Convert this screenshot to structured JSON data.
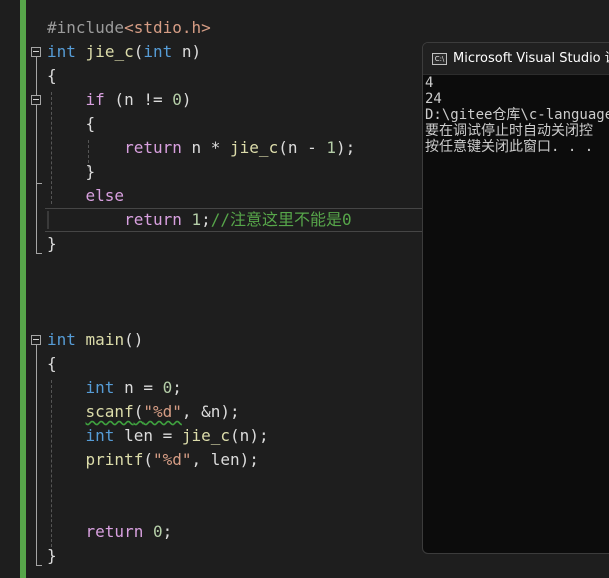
{
  "editor": {
    "lines": {
      "include_directive": "#include",
      "include_header": "<stdio.h>",
      "func_type": "int",
      "func_name": "jie_c",
      "func_open": "(",
      "func_param_type": "int",
      "func_param_name": " n)",
      "brace_open_1": "{",
      "if_kw": "if",
      "if_cond_a": " (n != ",
      "if_cond_num": "0",
      "if_cond_b": ")",
      "brace_open_2": "{",
      "return_kw_1": "return",
      "return_expr_a": " n * ",
      "return_call": "jie_c",
      "return_expr_b": "(n - ",
      "return_num_1": "1",
      "return_expr_c": ");",
      "brace_close_2": "}",
      "else_kw": "else",
      "return_kw_2": "return",
      "return_val_2": "1",
      "semicolon": ";",
      "comment": "//注意这里不能是0",
      "brace_close_1": "}",
      "main_type": "int",
      "main_name": "main",
      "main_parens": "()",
      "brace_open_3": "{",
      "decl_n_type": "int",
      "decl_n_rest": " n = ",
      "decl_n_num": "0",
      "decl_n_semi": ";",
      "scanf_name": "scanf",
      "scanf_open": "(",
      "scanf_fmt": "\"%d\"",
      "scanf_rest": ", &n);",
      "decl_len_type": "int",
      "decl_len_rest": " len = ",
      "decl_len_call": "jie_c",
      "decl_len_args": "(n);",
      "printf_name": "printf",
      "printf_open": "(",
      "printf_fmt": "\"%d\"",
      "printf_rest": ", len);",
      "return_kw_3": "return",
      "return_num_3": " 0",
      "return_semi_3": ";",
      "brace_close_3": "}"
    }
  },
  "console": {
    "icon_text": "C:\\",
    "title": "Microsoft Visual Studio 调试",
    "output": [
      "4",
      "24",
      "D:\\gitee仓库\\c-language",
      "要在调试停止时自动关闭控",
      "按任意键关闭此窗口. . ."
    ]
  },
  "colors": {
    "background": "#1e1e1e",
    "keyword": "#569cd6",
    "control_keyword": "#d8a0df",
    "function": "#dcdcaa",
    "number": "#b5cea8",
    "string": "#d69d85",
    "comment": "#57a64a",
    "change_bar": "#57a64a"
  }
}
